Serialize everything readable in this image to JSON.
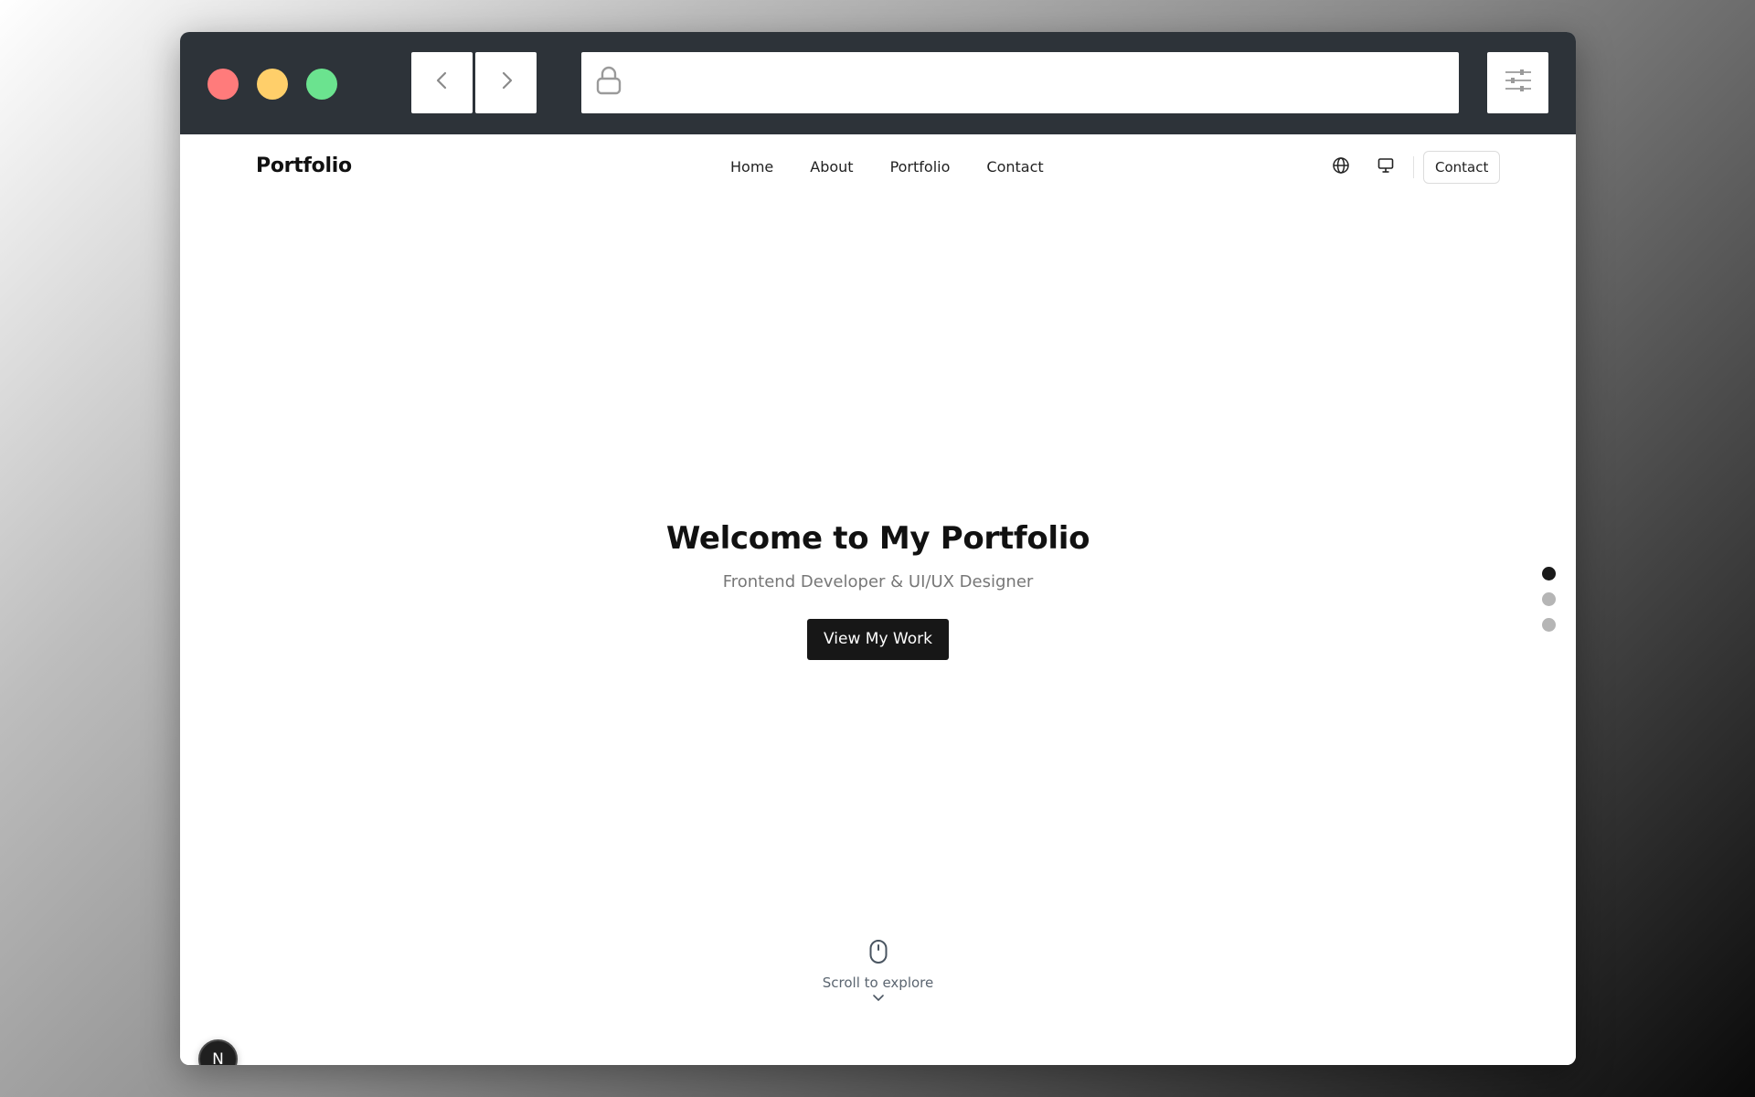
{
  "browser": {
    "address_value": "",
    "address_placeholder": ""
  },
  "site": {
    "logo": "Portfolio",
    "nav": [
      {
        "label": "Home"
      },
      {
        "label": "About"
      },
      {
        "label": "Portfolio"
      },
      {
        "label": "Contact"
      }
    ],
    "header_contact_label": "Contact"
  },
  "hero": {
    "title": "Welcome to My Portfolio",
    "subtitle": "Frontend Developer & UI/UX Designer",
    "cta_label": "View My Work"
  },
  "section_dots": {
    "count": 3,
    "active_index": 0
  },
  "scroll_hint": {
    "label": "Scroll to explore"
  },
  "floating_badge": {
    "letter": "N"
  },
  "colors": {
    "chrome": "#2d3339",
    "close": "#ff7b7b",
    "minimize": "#ffcf6a",
    "maximize": "#6be38f",
    "primary_button": "#171717"
  }
}
